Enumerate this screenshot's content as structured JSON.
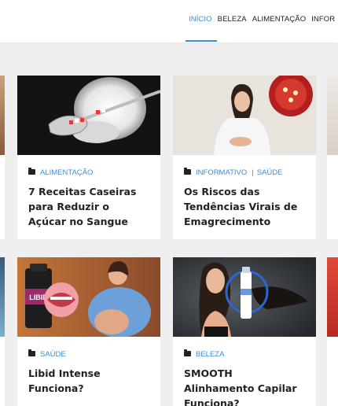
{
  "nav": {
    "items": [
      "INÍCIO",
      "BELEZA",
      "ALIMENTAÇÃO",
      "INFOR"
    ],
    "active_index": 0,
    "accent_color": "#3a8fd6"
  },
  "cards": [
    {
      "category": "ALIMENTAÇÃO",
      "title": "7 Receitas Caseiras para Reduzir o Açúcar no Sangue",
      "image": "sugar-spoon"
    },
    {
      "category_1": "INFORMATIVO",
      "separator": "|",
      "category_2": "SAÚDE",
      "title": "Os Riscos das Tendências Virais de Emagrecimento",
      "image": "woman-stomach"
    },
    {
      "category": "SAÚDE",
      "title": "Libid Intense Funciona?",
      "image": "product-couple"
    },
    {
      "category": "BELEZA",
      "title": "SMOOTH Alinhamento Capilar Funciona?",
      "image": "woman-hair-product"
    }
  ],
  "images": {
    "product_label": "LIBID"
  }
}
